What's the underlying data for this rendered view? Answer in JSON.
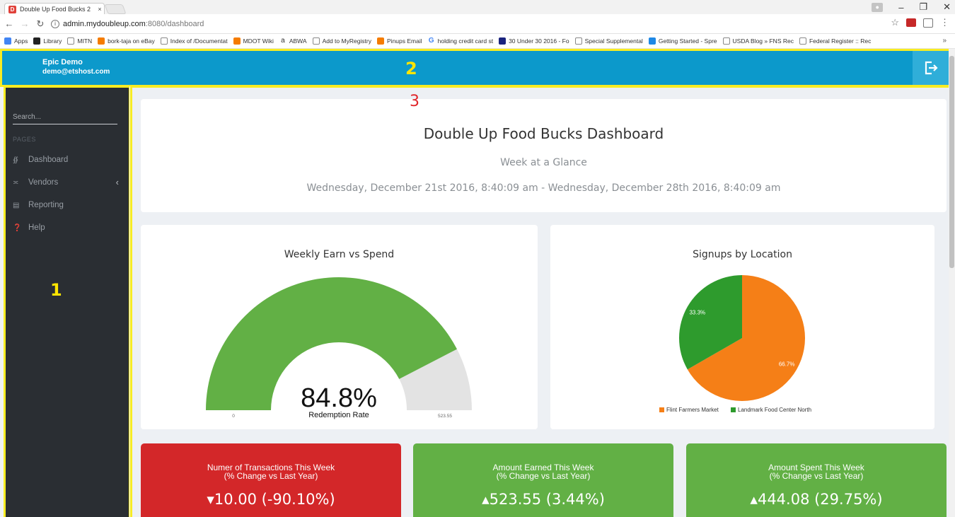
{
  "browser": {
    "tab_title": "Double Up Food Bucks 2",
    "tab_close": "×",
    "url_host": "admin.mydoubleup.com",
    "url_path": ":8080/dashboard",
    "bookmarks": [
      {
        "label": "Apps",
        "icon": "apps-grid-icon"
      },
      {
        "label": "Library",
        "icon": "library-icon"
      },
      {
        "label": "MITN",
        "icon": "page-icon"
      },
      {
        "label": "bork-taja on eBay",
        "icon": "ebay-icon"
      },
      {
        "label": "Index of /Documentat",
        "icon": "page-icon"
      },
      {
        "label": "MDOT Wiki",
        "icon": "mdot-icon"
      },
      {
        "label": "ABWA",
        "icon": "amazon-icon"
      },
      {
        "label": "Add to MyRegistry",
        "icon": "page-icon"
      },
      {
        "label": "Pinups Email",
        "icon": "pinups-icon"
      },
      {
        "label": "holding credit card st",
        "icon": "google-icon"
      },
      {
        "label": "30 Under 30 2016 - Fo",
        "icon": "forbes-icon"
      },
      {
        "label": "Special Supplemental",
        "icon": "usda-icon"
      },
      {
        "label": "Getting Started - Spre",
        "icon": "spreadsheet-icon"
      },
      {
        "label": "USDA Blog » FNS Rec",
        "icon": "page-icon"
      },
      {
        "label": "Federal Register :: Rec",
        "icon": "page-icon"
      }
    ],
    "more_bookmarks": "»"
  },
  "header": {
    "user_name": "Epic Demo",
    "user_email": "demo@etshost.com"
  },
  "annotations": {
    "sidebar_marker": "1",
    "header_marker": "2",
    "content_marker": "3"
  },
  "sidebar": {
    "search_placeholder": "Search...",
    "section_title": "PAGES",
    "items": [
      {
        "label": "Dashboard",
        "icon": "gauge-icon"
      },
      {
        "label": "Vendors",
        "icon": "cart-icon"
      },
      {
        "label": "Reporting",
        "icon": "bar-chart-icon"
      },
      {
        "label": "Help",
        "icon": "question-circle-icon"
      }
    ]
  },
  "dashboard": {
    "title": "Double Up Food Bucks Dashboard",
    "subtitle": "Week at a Glance",
    "date_range": "Wednesday, December 21st 2016, 8:40:09 am - Wednesday, December 28th 2016, 8:40:09 am"
  },
  "chart_data": [
    {
      "type": "gauge",
      "title": "Weekly Earn vs Spend",
      "value_label": "84.8%",
      "value_percent": 84.8,
      "caption": "Redemption Rate",
      "min_label": "0",
      "max_label": "523.55",
      "colors": {
        "fill": "#62b045",
        "track": "#e3e3e3"
      }
    },
    {
      "type": "pie",
      "title": "Signups by Location",
      "slices": [
        {
          "name": "Flint Farmers Market",
          "value": 66.7,
          "label": "66.7%",
          "color": "#f57f17"
        },
        {
          "name": "Landmark Food Center North",
          "value": 33.3,
          "label": "33.3%",
          "color": "#2e9b2d"
        }
      ]
    }
  ],
  "stats": [
    {
      "line1": "Numer of Transactions This Week",
      "line2": "(% Change vs Last Year)",
      "value": "▾10.00 (-90.10%)",
      "color": "#d32729"
    },
    {
      "line1": "Amount Earned This Week",
      "line2": "(% Change vs Last Year)",
      "value": "▴523.55 (3.44%)",
      "color": "#62b045"
    },
    {
      "line1": "Amount Spent This Week",
      "line2": "(% Change vs Last Year)",
      "value": "▴444.08 (29.75%)",
      "color": "#62b045"
    }
  ]
}
